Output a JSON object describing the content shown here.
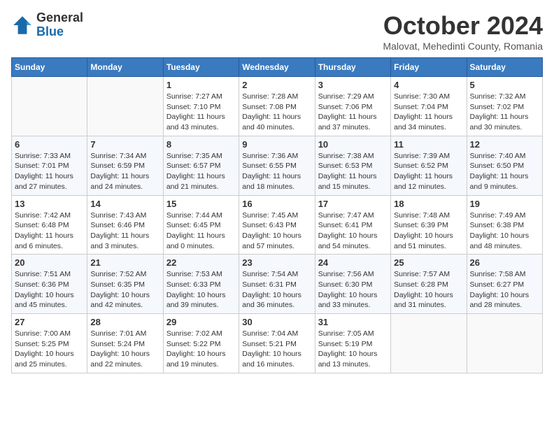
{
  "logo": {
    "general": "General",
    "blue": "Blue"
  },
  "title": "October 2024",
  "subtitle": "Malovat, Mehedinti County, Romania",
  "days_of_week": [
    "Sunday",
    "Monday",
    "Tuesday",
    "Wednesday",
    "Thursday",
    "Friday",
    "Saturday"
  ],
  "weeks": [
    [
      {
        "day": "",
        "sunrise": "",
        "sunset": "",
        "daylight": ""
      },
      {
        "day": "",
        "sunrise": "",
        "sunset": "",
        "daylight": ""
      },
      {
        "day": "1",
        "sunrise": "Sunrise: 7:27 AM",
        "sunset": "Sunset: 7:10 PM",
        "daylight": "Daylight: 11 hours and 43 minutes."
      },
      {
        "day": "2",
        "sunrise": "Sunrise: 7:28 AM",
        "sunset": "Sunset: 7:08 PM",
        "daylight": "Daylight: 11 hours and 40 minutes."
      },
      {
        "day": "3",
        "sunrise": "Sunrise: 7:29 AM",
        "sunset": "Sunset: 7:06 PM",
        "daylight": "Daylight: 11 hours and 37 minutes."
      },
      {
        "day": "4",
        "sunrise": "Sunrise: 7:30 AM",
        "sunset": "Sunset: 7:04 PM",
        "daylight": "Daylight: 11 hours and 34 minutes."
      },
      {
        "day": "5",
        "sunrise": "Sunrise: 7:32 AM",
        "sunset": "Sunset: 7:02 PM",
        "daylight": "Daylight: 11 hours and 30 minutes."
      }
    ],
    [
      {
        "day": "6",
        "sunrise": "Sunrise: 7:33 AM",
        "sunset": "Sunset: 7:01 PM",
        "daylight": "Daylight: 11 hours and 27 minutes."
      },
      {
        "day": "7",
        "sunrise": "Sunrise: 7:34 AM",
        "sunset": "Sunset: 6:59 PM",
        "daylight": "Daylight: 11 hours and 24 minutes."
      },
      {
        "day": "8",
        "sunrise": "Sunrise: 7:35 AM",
        "sunset": "Sunset: 6:57 PM",
        "daylight": "Daylight: 11 hours and 21 minutes."
      },
      {
        "day": "9",
        "sunrise": "Sunrise: 7:36 AM",
        "sunset": "Sunset: 6:55 PM",
        "daylight": "Daylight: 11 hours and 18 minutes."
      },
      {
        "day": "10",
        "sunrise": "Sunrise: 7:38 AM",
        "sunset": "Sunset: 6:53 PM",
        "daylight": "Daylight: 11 hours and 15 minutes."
      },
      {
        "day": "11",
        "sunrise": "Sunrise: 7:39 AM",
        "sunset": "Sunset: 6:52 PM",
        "daylight": "Daylight: 11 hours and 12 minutes."
      },
      {
        "day": "12",
        "sunrise": "Sunrise: 7:40 AM",
        "sunset": "Sunset: 6:50 PM",
        "daylight": "Daylight: 11 hours and 9 minutes."
      }
    ],
    [
      {
        "day": "13",
        "sunrise": "Sunrise: 7:42 AM",
        "sunset": "Sunset: 6:48 PM",
        "daylight": "Daylight: 11 hours and 6 minutes."
      },
      {
        "day": "14",
        "sunrise": "Sunrise: 7:43 AM",
        "sunset": "Sunset: 6:46 PM",
        "daylight": "Daylight: 11 hours and 3 minutes."
      },
      {
        "day": "15",
        "sunrise": "Sunrise: 7:44 AM",
        "sunset": "Sunset: 6:45 PM",
        "daylight": "Daylight: 11 hours and 0 minutes."
      },
      {
        "day": "16",
        "sunrise": "Sunrise: 7:45 AM",
        "sunset": "Sunset: 6:43 PM",
        "daylight": "Daylight: 10 hours and 57 minutes."
      },
      {
        "day": "17",
        "sunrise": "Sunrise: 7:47 AM",
        "sunset": "Sunset: 6:41 PM",
        "daylight": "Daylight: 10 hours and 54 minutes."
      },
      {
        "day": "18",
        "sunrise": "Sunrise: 7:48 AM",
        "sunset": "Sunset: 6:39 PM",
        "daylight": "Daylight: 10 hours and 51 minutes."
      },
      {
        "day": "19",
        "sunrise": "Sunrise: 7:49 AM",
        "sunset": "Sunset: 6:38 PM",
        "daylight": "Daylight: 10 hours and 48 minutes."
      }
    ],
    [
      {
        "day": "20",
        "sunrise": "Sunrise: 7:51 AM",
        "sunset": "Sunset: 6:36 PM",
        "daylight": "Daylight: 10 hours and 45 minutes."
      },
      {
        "day": "21",
        "sunrise": "Sunrise: 7:52 AM",
        "sunset": "Sunset: 6:35 PM",
        "daylight": "Daylight: 10 hours and 42 minutes."
      },
      {
        "day": "22",
        "sunrise": "Sunrise: 7:53 AM",
        "sunset": "Sunset: 6:33 PM",
        "daylight": "Daylight: 10 hours and 39 minutes."
      },
      {
        "day": "23",
        "sunrise": "Sunrise: 7:54 AM",
        "sunset": "Sunset: 6:31 PM",
        "daylight": "Daylight: 10 hours and 36 minutes."
      },
      {
        "day": "24",
        "sunrise": "Sunrise: 7:56 AM",
        "sunset": "Sunset: 6:30 PM",
        "daylight": "Daylight: 10 hours and 33 minutes."
      },
      {
        "day": "25",
        "sunrise": "Sunrise: 7:57 AM",
        "sunset": "Sunset: 6:28 PM",
        "daylight": "Daylight: 10 hours and 31 minutes."
      },
      {
        "day": "26",
        "sunrise": "Sunrise: 7:58 AM",
        "sunset": "Sunset: 6:27 PM",
        "daylight": "Daylight: 10 hours and 28 minutes."
      }
    ],
    [
      {
        "day": "27",
        "sunrise": "Sunrise: 7:00 AM",
        "sunset": "Sunset: 5:25 PM",
        "daylight": "Daylight: 10 hours and 25 minutes."
      },
      {
        "day": "28",
        "sunrise": "Sunrise: 7:01 AM",
        "sunset": "Sunset: 5:24 PM",
        "daylight": "Daylight: 10 hours and 22 minutes."
      },
      {
        "day": "29",
        "sunrise": "Sunrise: 7:02 AM",
        "sunset": "Sunset: 5:22 PM",
        "daylight": "Daylight: 10 hours and 19 minutes."
      },
      {
        "day": "30",
        "sunrise": "Sunrise: 7:04 AM",
        "sunset": "Sunset: 5:21 PM",
        "daylight": "Daylight: 10 hours and 16 minutes."
      },
      {
        "day": "31",
        "sunrise": "Sunrise: 7:05 AM",
        "sunset": "Sunset: 5:19 PM",
        "daylight": "Daylight: 10 hours and 13 minutes."
      },
      {
        "day": "",
        "sunrise": "",
        "sunset": "",
        "daylight": ""
      },
      {
        "day": "",
        "sunrise": "",
        "sunset": "",
        "daylight": ""
      }
    ]
  ]
}
